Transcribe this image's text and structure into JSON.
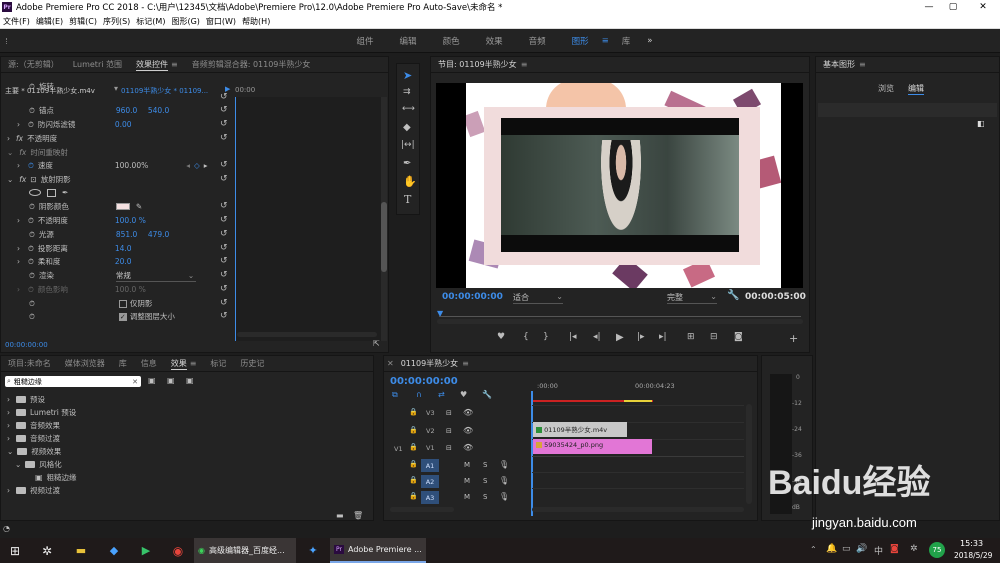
{
  "window": {
    "title": "Adobe Premiere Pro CC 2018 - C:\\用户\\12345\\文档\\Adobe\\Premiere Pro\\12.0\\Adobe Premiere Pro Auto-Save\\未命名 *",
    "minimize": "—",
    "maximize": "▢",
    "close": "✕"
  },
  "menu": [
    "文件(F)",
    "编辑(E)",
    "剪辑(C)",
    "序列(S)",
    "标记(M)",
    "图形(G)",
    "窗口(W)",
    "帮助(H)"
  ],
  "workspaces": {
    "items": [
      "组件",
      "编辑",
      "颜色",
      "效果",
      "音频",
      "图形",
      "库"
    ],
    "active": "图形",
    "more": "»"
  },
  "effect_controls": {
    "tabs": [
      "源:（无剪辑）",
      "Lumetri 范围",
      "效果控件",
      "音频剪辑混合器: 01109半熟少女"
    ],
    "active_tab": "效果控件",
    "master_clip": "主要 * 01109半熟少女.m4v",
    "sequence_clip": "01109半熟少女 * 01109...",
    "timeline_start": "00:00",
    "rows": [
      {
        "label": "旋转",
        "v1": "",
        "v2": ""
      },
      {
        "label": "锚点",
        "v1": "960.0",
        "v2": "540.0"
      },
      {
        "label": "防闪烁滤镜",
        "v1": "0.00",
        "v2": ""
      },
      {
        "label": "不透明度",
        "v1": "",
        "v2": ""
      },
      {
        "label": "时间重映射",
        "v1": "",
        "v2": ""
      },
      {
        "label": "速度",
        "v1": "100.00%",
        "v2": ""
      },
      {
        "label": "放射阴影",
        "v1": "",
        "v2": ""
      },
      {
        "label": "阴影颜色",
        "v1": "",
        "v2": ""
      },
      {
        "label": "不透明度",
        "v1": "100.0 %",
        "v2": ""
      },
      {
        "label": "光源",
        "v1": "851.0",
        "v2": "479.0"
      },
      {
        "label": "投影距离",
        "v1": "14.0",
        "v2": ""
      },
      {
        "label": "柔和度",
        "v1": "20.0",
        "v2": ""
      },
      {
        "label": "渲染",
        "v1": "常规",
        "v2": ""
      },
      {
        "label": "颜色影响",
        "v1": "100.0 %",
        "v2": ""
      },
      {
        "label": "",
        "v1": "仅阴影",
        "v2": ""
      },
      {
        "label": "",
        "v1": "调整图层大小",
        "v2": ""
      }
    ],
    "fx_label": "fx",
    "timecode": "00:00:00:00"
  },
  "program_monitor": {
    "tab": "节目: 01109半熟少女",
    "timecode_in": "00:00:00:00",
    "fit": "适合",
    "quality": "完整",
    "timecode_out": "00:00:05:00"
  },
  "essential_graphics": {
    "tab": "基本图形",
    "subtabs": [
      "浏览",
      "编辑"
    ],
    "active_subtab": "编辑"
  },
  "project_panel": {
    "tabs": [
      "项目:未命名",
      "媒体浏览器",
      "库",
      "信息",
      "效果",
      "标记",
      "历史记"
    ],
    "active_tab": "效果",
    "search_value": "粗糙边缘",
    "tree": [
      {
        "label": "预设",
        "indent": 0
      },
      {
        "label": "Lumetri 预设",
        "indent": 0
      },
      {
        "label": "音频效果",
        "indent": 0
      },
      {
        "label": "音频过渡",
        "indent": 0
      },
      {
        "label": "视频效果",
        "indent": 0
      },
      {
        "label": "风格化",
        "indent": 1
      },
      {
        "label": "粗糙边缘",
        "indent": 2
      },
      {
        "label": "视频过渡",
        "indent": 0
      }
    ]
  },
  "timeline": {
    "tab": "01109半熟少女",
    "timecode": "00:00:00:00",
    "ruler": [
      ":00:00",
      "00:00:04:23"
    ],
    "video_tracks": [
      "V3",
      "V2",
      "V1"
    ],
    "audio_tracks": [
      "A1",
      "A2",
      "A3"
    ],
    "source_v": "V1",
    "clips": [
      {
        "label": "01109半熟少女.m4v",
        "track": "V2"
      },
      {
        "label": "59035424_p0.png",
        "track": "V1"
      }
    ],
    "meter_marks": [
      "0",
      "-12",
      "-24",
      "-36",
      "-48",
      "dB"
    ]
  },
  "taskbar": {
    "apps": [
      "高级编辑器_百度经...",
      "Adobe Premiere ..."
    ],
    "time": "15:33",
    "date": "2018/5/29",
    "badge": "75"
  },
  "watermark": {
    "brand": "Baidu经验",
    "url": "jingyan.baidu.com"
  },
  "colors": {
    "accent": "#3d8ce8",
    "playhead": "#3d8ce8",
    "clip_v2": "#c8c8c8",
    "clip_v1": "#e276d6"
  }
}
